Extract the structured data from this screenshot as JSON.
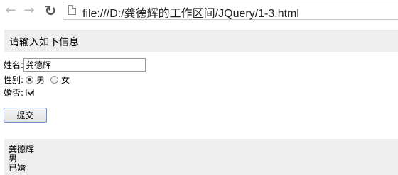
{
  "browser": {
    "back_icon": "arrow-left-icon",
    "forward_icon": "arrow-right-icon",
    "reload_icon": "reload-icon",
    "page_icon": "file-page-icon",
    "url": "file:///D:/龚德辉的工作区间/JQuery/1-3.html"
  },
  "banner": {
    "title": "请输入如下信息"
  },
  "form": {
    "name_label": "姓名:",
    "name_value": "龚德辉",
    "gender_label": "性别:",
    "gender_options": [
      "男",
      "女"
    ],
    "gender_selected": "男",
    "married_label": "婚否:",
    "married_checked": true,
    "submit_label": "提交"
  },
  "output": {
    "lines": [
      "龚德辉",
      "男",
      "已婚"
    ]
  }
}
